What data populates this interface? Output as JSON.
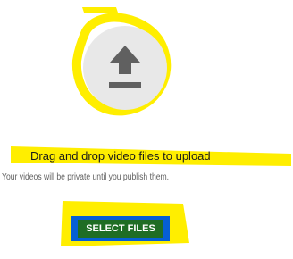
{
  "upload_area": {
    "icon": "upload-icon",
    "title": "Drag and drop video files to upload",
    "subtitle": "Your videos will be private until you publish them."
  },
  "actions": {
    "select_files_label": "SELECT FILES"
  },
  "colors": {
    "button_blue": "#065fd4",
    "annotation_yellow": "#ffee00",
    "button_overlay_green": "#1f6d24",
    "icon_gray": "#606060"
  }
}
